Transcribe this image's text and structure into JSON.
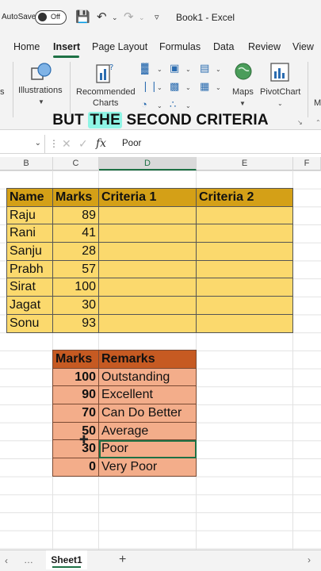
{
  "titlebar": {
    "autosave_label": "AutoSave",
    "toggle_state": "Off",
    "title": "Book1 - Excel"
  },
  "tabs": [
    "Home",
    "Insert",
    "Page Layout",
    "Formulas",
    "Data",
    "Review",
    "View"
  ],
  "active_tab": "Insert",
  "ribbon": {
    "illustrations": "Illustrations",
    "recommended_charts_1": "Recommended",
    "recommended_charts_2": "Charts",
    "maps": "Maps",
    "pivotchart": "PivotChart",
    "left_cut": "s",
    "right_cut": "M"
  },
  "caption": {
    "pre": "BUT ",
    "highlight": "THE",
    "post": " SECOND CRITERIA"
  },
  "formula_bar": {
    "fx": "fx",
    "value": "Poor"
  },
  "columns": [
    "B",
    "C",
    "D",
    "E",
    "F"
  ],
  "table1": {
    "headers": [
      "Name",
      "Marks",
      "Criteria 1",
      "Criteria 2"
    ],
    "rows": [
      [
        "Raju",
        "89",
        "",
        ""
      ],
      [
        "Rani",
        "41",
        "",
        ""
      ],
      [
        "Sanju",
        "28",
        "",
        ""
      ],
      [
        "Prabh",
        "57",
        "",
        ""
      ],
      [
        "Sirat",
        "100",
        "",
        ""
      ],
      [
        "Jagat",
        "30",
        "",
        ""
      ],
      [
        "Sonu",
        "93",
        "",
        ""
      ]
    ]
  },
  "table2": {
    "headers": [
      "Marks",
      "Remarks"
    ],
    "rows": [
      [
        "100",
        "Outstanding"
      ],
      [
        "90",
        "Excellent"
      ],
      [
        "70",
        "Can Do Better"
      ],
      [
        "50",
        "Average"
      ],
      [
        "30",
        "Poor"
      ],
      [
        "0",
        "Very Poor"
      ]
    ]
  },
  "sheet_tab": "Sheet1",
  "colors": {
    "accent": "#1e7145",
    "table1_header": "#d4a017",
    "table1_body": "#fbd96d",
    "table2_header": "#c65a22",
    "table2_body": "#f3ad8a",
    "caption_highlight": "#8ff5e6"
  }
}
